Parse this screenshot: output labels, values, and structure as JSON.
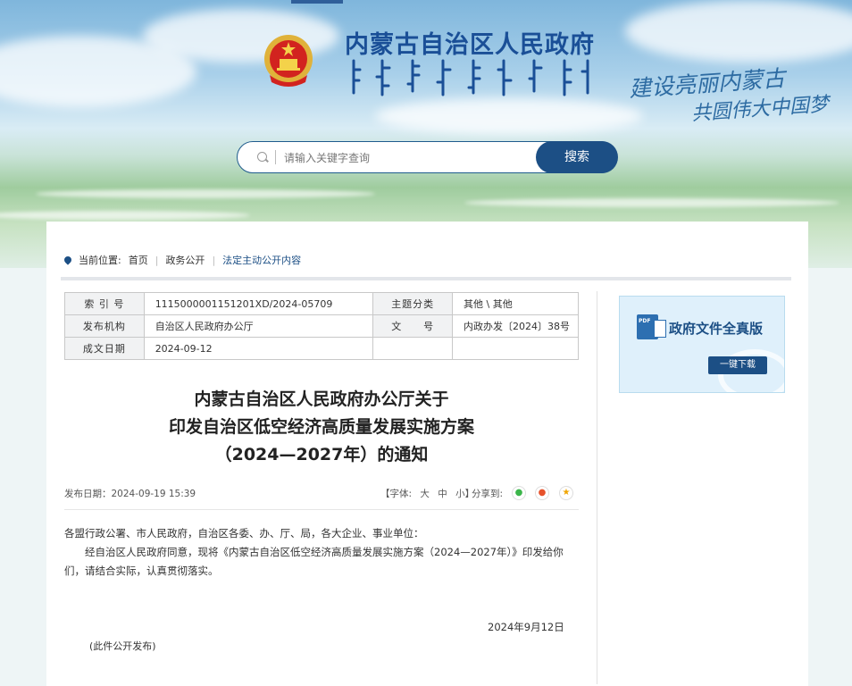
{
  "header": {
    "site_title": "内蒙古自治区人民政府",
    "slogan_line1": "建设亮丽内蒙古",
    "slogan_line2": "共圆伟大中国梦"
  },
  "search": {
    "placeholder": "请输入关键字查询",
    "button_label": "搜索"
  },
  "breadcrumb": {
    "prefix": "当前位置:",
    "items": [
      "首页",
      "政务公开",
      "法定主动公开内容"
    ]
  },
  "meta_table": {
    "index_label": "索 引 号",
    "index_value": "1115000001151201XD/2024-05709",
    "category_label": "主题分类",
    "category_value": "其他 \\ 其他",
    "issuer_label": "发布机构",
    "issuer_value": "自治区人民政府办公厅",
    "docno_label": "文　　号",
    "docno_value": "内政办发〔2024〕38号",
    "date_label": "成文日期",
    "date_value": "2024-09-12"
  },
  "download": {
    "pdf_icon": "PDF",
    "title": "政府文件全真版",
    "button_label": "一键下载"
  },
  "document": {
    "title_line1": "内蒙古自治区人民政府办公厅关于",
    "title_line2": "印发自治区低空经济高质量发展实施方案",
    "title_line3": "（2024—2027年）的通知",
    "publish_date": "发布日期：2024-09-19 15:39",
    "font_label_prefix": "【字体:",
    "font_large": "大",
    "font_medium": "中",
    "font_small": "小】",
    "share_label": "分享到:",
    "salutation": "各盟行政公署、市人民政府，自治区各委、办、厅、局，各大企业、事业单位：",
    "body": "经自治区人民政府同意，现将《内蒙古自治区低空经济高质量发展实施方案（2024—2027年）》印发给你们，请结合实际，认真贯彻落实。",
    "sign_date": "2024年9月12日",
    "note": "(此件公开发布)"
  },
  "colors": {
    "brand_blue": "#1c4f85",
    "title_blue": "#1a4f97"
  }
}
